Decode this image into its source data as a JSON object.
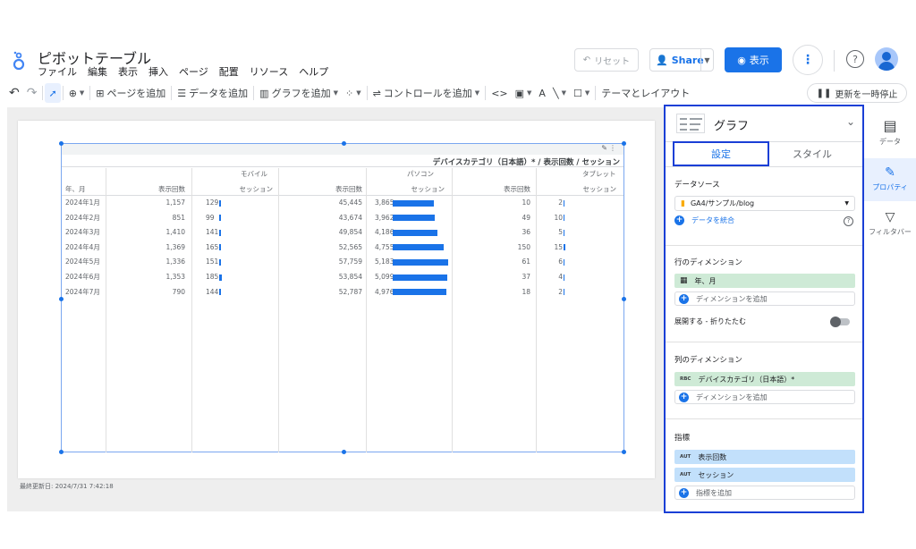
{
  "app": {
    "title": "ピボットテーブル",
    "menu": [
      "ファイル",
      "編集",
      "表示",
      "挿入",
      "ページ",
      "配置",
      "リソース",
      "ヘルプ"
    ],
    "reset_label": "リセット",
    "share_label": "Share",
    "view_label": "表示",
    "help_label": "?"
  },
  "toolbar": {
    "add_page": "ページを追加",
    "add_data": "データを追加",
    "add_chart": "グラフを追加",
    "add_control": "コントロールを追加",
    "theme_layout": "テーマとレイアウト",
    "pause_updates": "更新を一時停止"
  },
  "colors": {
    "accent": "#1a73e8",
    "selection": "#1a3fd6",
    "dimension_chip": "#ceead6",
    "metric_chip": "#c2e0fb"
  },
  "table": {
    "column_dimension_title": "デバイスカテゴリ（日本語）* / 表示回数 / セッション",
    "row_header": "年、月",
    "groups": [
      "モバイル",
      "パソコン",
      "タブレット"
    ],
    "metric_headers": [
      "表示回数",
      "セッション"
    ],
    "rows": [
      {
        "month": "2024年1月",
        "mobile_views": "1,157",
        "mobile_sessions": "129",
        "mobile_sessions_n": 129,
        "pc_views": "45,445",
        "pc_sessions": "3,865",
        "pc_sessions_n": 3865,
        "tablet_views": "10",
        "tablet_sessions": "2",
        "tablet_sessions_n": 2
      },
      {
        "month": "2024年2月",
        "mobile_views": "851",
        "mobile_sessions": "99",
        "mobile_sessions_n": 99,
        "pc_views": "43,674",
        "pc_sessions": "3,962",
        "pc_sessions_n": 3962,
        "tablet_views": "49",
        "tablet_sessions": "10",
        "tablet_sessions_n": 10
      },
      {
        "month": "2024年3月",
        "mobile_views": "1,410",
        "mobile_sessions": "141",
        "mobile_sessions_n": 141,
        "pc_views": "49,854",
        "pc_sessions": "4,186",
        "pc_sessions_n": 4186,
        "tablet_views": "36",
        "tablet_sessions": "5",
        "tablet_sessions_n": 5
      },
      {
        "month": "2024年4月",
        "mobile_views": "1,369",
        "mobile_sessions": "165",
        "mobile_sessions_n": 165,
        "pc_views": "52,565",
        "pc_sessions": "4,755",
        "pc_sessions_n": 4755,
        "tablet_views": "150",
        "tablet_sessions": "15",
        "tablet_sessions_n": 15
      },
      {
        "month": "2024年5月",
        "mobile_views": "1,336",
        "mobile_sessions": "151",
        "mobile_sessions_n": 151,
        "pc_views": "57,759",
        "pc_sessions": "5,183",
        "pc_sessions_n": 5183,
        "tablet_views": "61",
        "tablet_sessions": "6",
        "tablet_sessions_n": 6
      },
      {
        "month": "2024年6月",
        "mobile_views": "1,353",
        "mobile_sessions": "185",
        "mobile_sessions_n": 185,
        "pc_views": "53,854",
        "pc_sessions": "5,099",
        "pc_sessions_n": 5099,
        "tablet_views": "37",
        "tablet_sessions": "4",
        "tablet_sessions_n": 4
      },
      {
        "month": "2024年7月",
        "mobile_views": "790",
        "mobile_sessions": "144",
        "mobile_sessions_n": 144,
        "pc_views": "52,787",
        "pc_sessions": "4,976",
        "pc_sessions_n": 4976,
        "tablet_views": "18",
        "tablet_sessions": "2",
        "tablet_sessions_n": 2
      }
    ]
  },
  "canvas": {
    "last_updated": "最終更新日: 2024/7/31 7:42:18"
  },
  "panel": {
    "title": "グラフ",
    "tab_setup": "設定",
    "tab_style": "スタイル",
    "data_source_label": "データソース",
    "data_source_value": "GA4/サンプル/blog",
    "blend_data": "データを統合",
    "row_dimension_label": "行のディメンション",
    "row_dimension_value": "年、月",
    "add_dimension": "ディメンションを追加",
    "expand_collapse": "展開する - 折りたたむ",
    "column_dimension_label": "列のディメンション",
    "column_dimension_tag": "RBC",
    "column_dimension_value": "デバイスカテゴリ（日本語）*",
    "metrics_label": "指標",
    "metric_tag": "AUT",
    "metric_1": "表示回数",
    "metric_2": "セッション",
    "add_metric": "指標を追加"
  },
  "rail": {
    "data": "データ",
    "properties": "プロパティ",
    "filter": "フィルタバー"
  }
}
